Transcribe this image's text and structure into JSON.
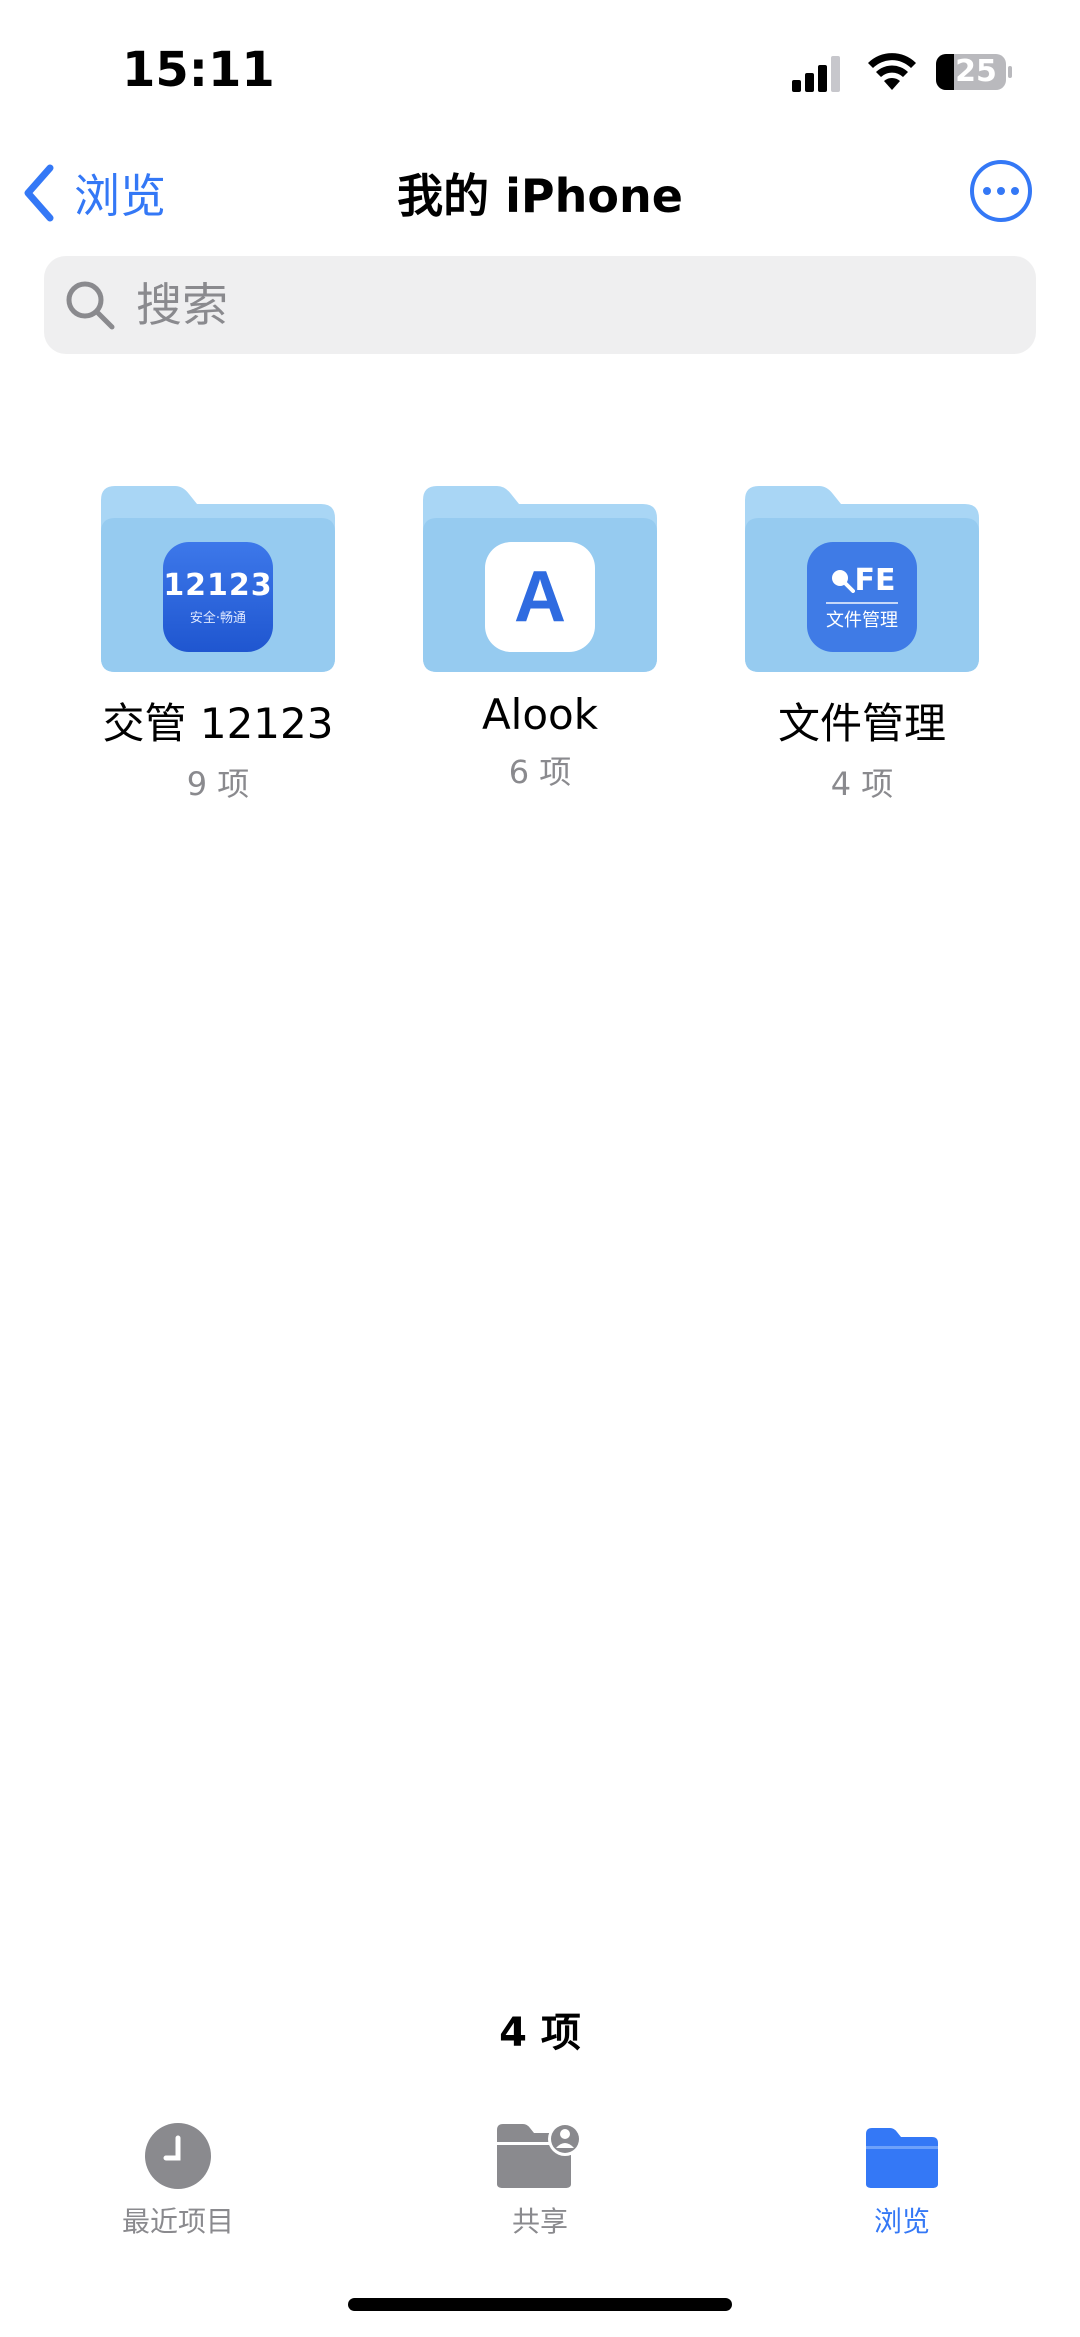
{
  "status_bar": {
    "time": "15:11",
    "battery": "25"
  },
  "nav": {
    "back_label": "浏览",
    "title": "我的 iPhone",
    "more_icon": "ellipsis-circle-icon"
  },
  "search": {
    "placeholder": "搜索"
  },
  "folders": [
    {
      "name": "交管 12123",
      "count": "9 项",
      "app_badge_text": "12123",
      "app_badge_sub": "安全·畅通"
    },
    {
      "name": "Alook",
      "count": "6 项",
      "app_badge_text": "A"
    },
    {
      "name": "文件管理",
      "count": "4 项",
      "app_badge_text": "FE",
      "app_badge_sub": "文件管理"
    }
  ],
  "footer": {
    "item_count": "4 项"
  },
  "tabs": [
    {
      "label": "最近项目",
      "icon": "clock-icon",
      "active": false
    },
    {
      "label": "共享",
      "icon": "shared-folder-icon",
      "active": false
    },
    {
      "label": "浏览",
      "icon": "folder-icon",
      "active": true
    }
  ],
  "colors": {
    "accent": "#3478f6",
    "folder": "#a9d6f5",
    "secondary_text": "#8a8a8e",
    "search_bg": "#efeff0"
  }
}
